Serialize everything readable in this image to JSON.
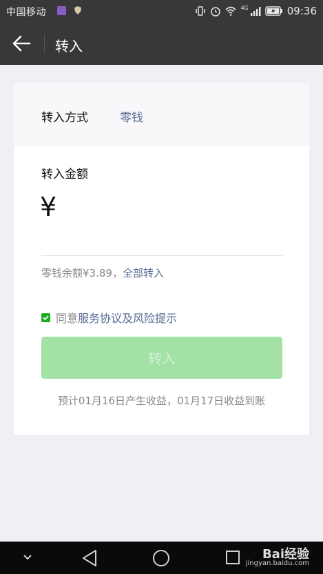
{
  "status_bar": {
    "carrier": "中国移动",
    "network": "4G",
    "time": "09:36",
    "icons": [
      "app-icon",
      "vibrate-icon",
      "alarm-icon",
      "wifi-icon",
      "signal-icon",
      "battery-icon"
    ]
  },
  "nav": {
    "title": "转入",
    "back_icon": "arrow-left-icon"
  },
  "form": {
    "method_label": "转入方式",
    "method_value": "零钱",
    "amount_label": "转入金额",
    "currency_symbol": "¥",
    "amount_value": "",
    "balance_text": "零钱余额¥3.89，",
    "transfer_all": "全部转入",
    "agree_prefix": "同意",
    "agree_link": "服务协议及风险提示",
    "agree_checked": true,
    "submit_label": "转入",
    "estimate_text": "预计01月16日产生收益，01月17日收益到账"
  },
  "colors": {
    "accent_link": "#576b95",
    "check_green": "#1aad19",
    "button_disabled": "#a3e1a5",
    "header_bg": "#38383a"
  },
  "watermark": {
    "brand": "Bai经验",
    "site": "jingyan.baidu.com"
  }
}
